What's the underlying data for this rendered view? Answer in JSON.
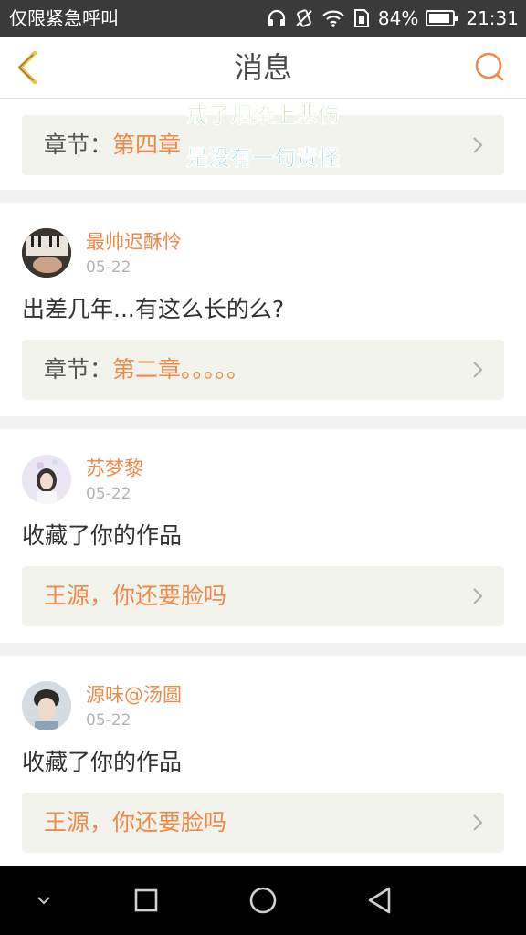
{
  "status_bar": {
    "carrier": "仅限紧急呼叫",
    "battery_percent": "84%",
    "time": "21:31",
    "icons": [
      "headphones-icon",
      "vibrate-icon",
      "wifi-icon",
      "sim-icon",
      "battery-icon"
    ]
  },
  "header": {
    "title": "消息",
    "back_icon": "chevron-left-icon",
    "search_icon": "search-icon",
    "accent_color": "#f08a4b"
  },
  "overlay_lyrics": [
    "戒了烟染上悲伤",
    "是没有一句责怪"
  ],
  "messages": [
    {
      "chapter_prefix": "章节：",
      "chapter_name": "第四章"
    },
    {
      "username": "最帅迟酥怜",
      "date": "05-22",
      "text": "出差几年...有这么长的么?",
      "chapter_prefix": "章节：",
      "chapter_name": "第二章。。。。。"
    },
    {
      "username": "苏梦黎",
      "date": "05-22",
      "text": "收藏了你的作品",
      "work_title": "王源，你还要脸吗"
    },
    {
      "username": "源味@汤圆",
      "date": "05-22",
      "text": "收藏了你的作品",
      "work_title": "王源，你还要脸吗"
    }
  ],
  "nav_bar": {
    "icons": [
      "chevron-down-icon",
      "recents-square-icon",
      "home-circle-icon",
      "back-triangle-icon"
    ]
  }
}
